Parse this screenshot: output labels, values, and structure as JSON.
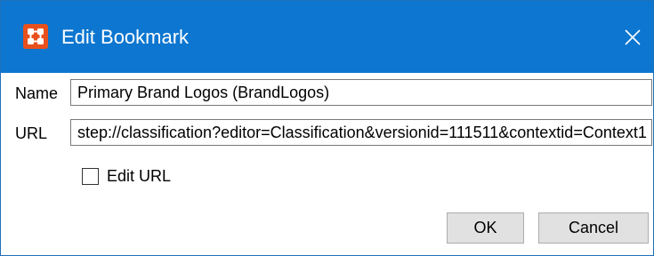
{
  "window": {
    "title": "Edit Bookmark",
    "app_icon": "stibo-app-icon",
    "close_icon": "close-icon",
    "accent": "#0c76d0",
    "icon_color": "#e8501e"
  },
  "form": {
    "name_label": "Name",
    "name_value": "Primary Brand Logos (BrandLogos)",
    "url_label": "URL",
    "url_value": "step://classification?editor=Classification&versionid=111511&contextid=Context1",
    "edit_url_label": "Edit URL",
    "edit_url_checked": false
  },
  "buttons": {
    "ok": "OK",
    "cancel": "Cancel"
  }
}
